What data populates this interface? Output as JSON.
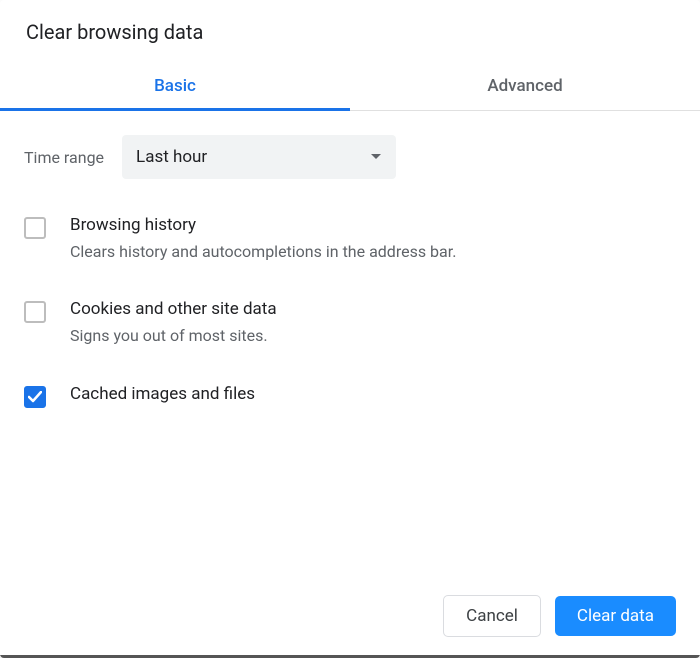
{
  "title": "Clear browsing data",
  "tabs": {
    "basic": "Basic",
    "advanced": "Advanced"
  },
  "timeRange": {
    "label": "Time range",
    "selected": "Last hour"
  },
  "options": [
    {
      "title": "Browsing history",
      "desc": "Clears history and autocompletions in the address bar.",
      "checked": false
    },
    {
      "title": "Cookies and other site data",
      "desc": "Signs you out of most sites.",
      "checked": false
    },
    {
      "title": "Cached images and files",
      "desc": "",
      "checked": true
    }
  ],
  "buttons": {
    "cancel": "Cancel",
    "clear": "Clear data"
  }
}
